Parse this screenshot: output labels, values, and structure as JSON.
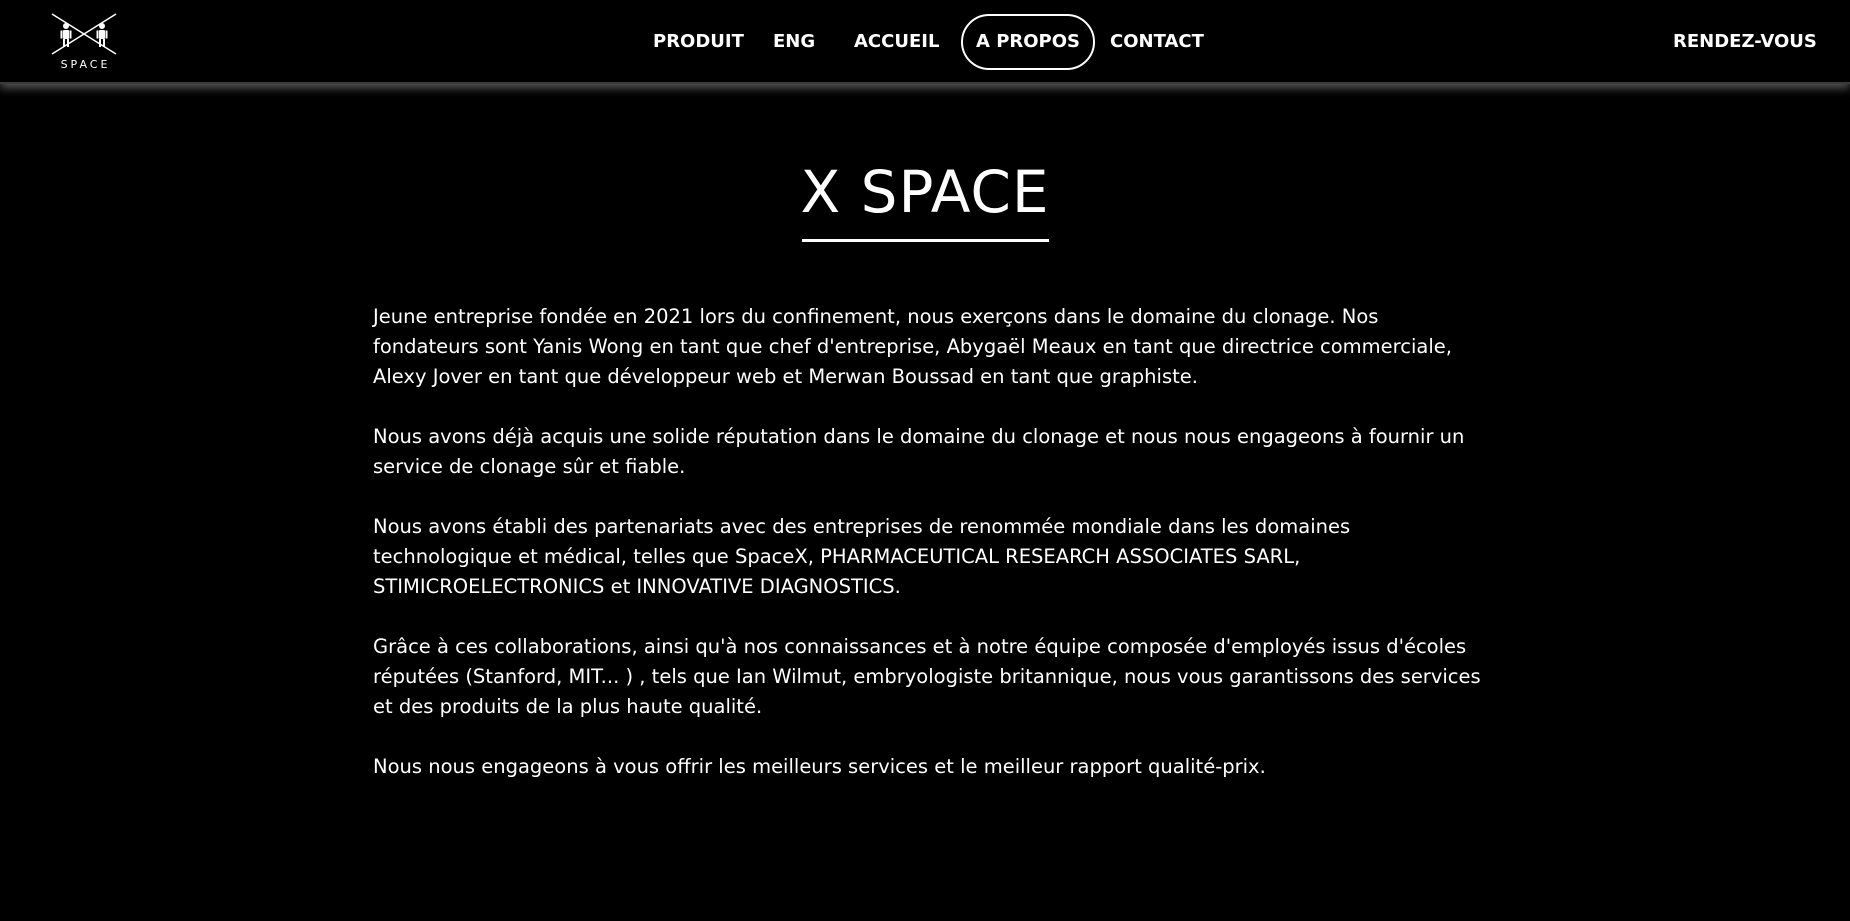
{
  "header": {
    "logo_text": "SPACE",
    "nav": {
      "produit": "PRODUIT",
      "eng": "ENG",
      "accueil": "ACCUEIL",
      "apropos": "A PROPOS",
      "contact": "CONTACT"
    },
    "cta": "RENDEZ-VOUS"
  },
  "main": {
    "title": "X SPACE",
    "paragraphs": [
      "Jeune entreprise fondée en 2021 lors du confinement, nous exerçons dans le domaine du clonage. Nos fondateurs sont Yanis Wong en tant que chef d'entreprise, Abygaël Meaux en tant que directrice commerciale, Alexy Jover en tant que développeur web et Merwan Boussad en tant que graphiste.",
      "Nous avons déjà acquis une solide réputation dans le domaine du clonage et nous nous engageons à fournir un service de clonage sûr et fiable.",
      "Nous avons établi des partenariats avec des entreprises de renommée mondiale dans les domaines technologique et médical, telles que SpaceX, PHARMACEUTICAL RESEARCH ASSOCIATES SARL, STIMICROELECTRONICS et INNOVATIVE DIAGNOSTICS.",
      "Grâce à ces collaborations, ainsi qu'à nos connaissances et à notre équipe composée d'employés issus d'écoles réputées (Stanford, MIT... ) , tels que Ian Wilmut, embryologiste britannique, nous vous garantissons des services et des produits de la plus haute qualité.",
      "Nous nous engageons à vous offrir les meilleurs services et le meilleur rapport qualité-prix."
    ]
  },
  "colors": {
    "background": "#000000",
    "text": "#ffffff"
  },
  "icons": {
    "logo": "x-space-logo-icon"
  }
}
